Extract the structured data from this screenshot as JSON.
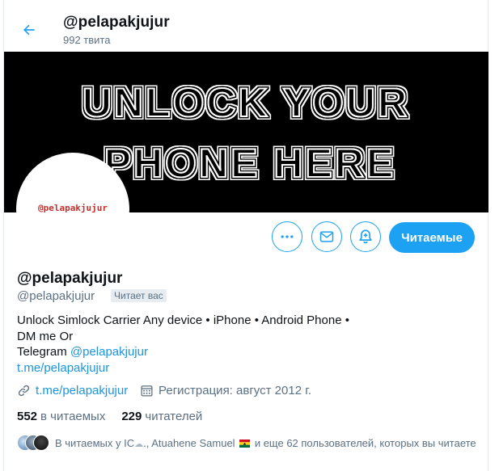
{
  "header": {
    "title": "@pelapakjujur",
    "tweet_count": "992 твита"
  },
  "banner": {
    "line1": "UNLOCK YOUR",
    "line2": "PHONE HERE"
  },
  "avatar": {
    "text": "@pelapakjujur",
    "text_color": "#c4302b"
  },
  "actions": {
    "more_icon": "more-horizontal-icon",
    "message_icon": "envelope-icon",
    "notify_icon": "bell-plus-icon",
    "follow_label": "Читаемые"
  },
  "profile": {
    "name": "@pelapakjujur",
    "handle": "@pelapakjujur",
    "follows_you": "Читает вас",
    "bio_line1": "Unlock Simlock Carrier Any device • iPhone • Android Phone •",
    "bio_line2": "DM me Or",
    "bio_line3_prefix": "Telegram ",
    "bio_line3_mention": "@pelapakjujur",
    "bio_line4_link": "t.me/pelapakjujur",
    "website": "t.me/pelapakjujur",
    "joined": "Регистрация: август 2012 г."
  },
  "stats": {
    "following_count": "552",
    "following_label": "в читаемых",
    "followers_count": "229",
    "followers_label": "читателей"
  },
  "followed_by": {
    "prefix": "В читаемых у IC",
    "middle": "., Atuahene Samuel",
    "suffix": "и еще 62 пользователей, которых вы читаете"
  },
  "colors": {
    "accent": "#1da1f2",
    "link": "#1b95e0",
    "secondary_text": "#5b7083",
    "banner_bg": "#000000"
  }
}
